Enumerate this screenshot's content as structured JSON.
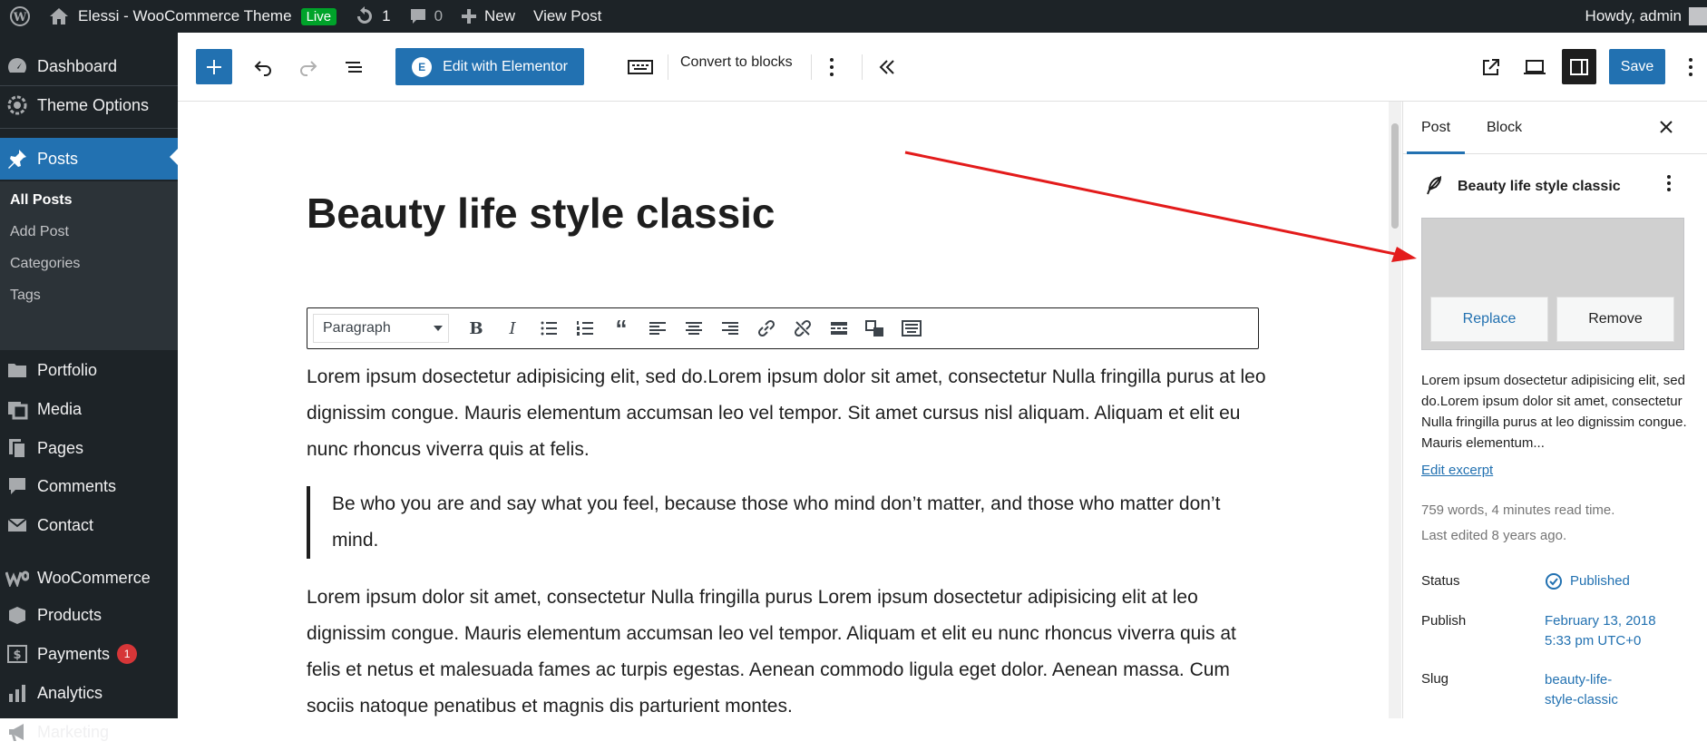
{
  "adminbar": {
    "site_name": "Elessi - WooCommerce Theme",
    "live_badge": "Live",
    "updates_count": "1",
    "comments_count": "0",
    "new_label": "New",
    "view_post_label": "View Post",
    "greeting": "Howdy, admin"
  },
  "sidebar": {
    "items": [
      {
        "label": "Dashboard",
        "icon": "dashboard-icon"
      },
      {
        "label": "Theme Options",
        "icon": "gear-icon"
      },
      {
        "label": "Posts",
        "icon": "pin-icon"
      },
      {
        "label": "Portfolio",
        "icon": "folder-icon"
      },
      {
        "label": "Media",
        "icon": "media-icon"
      },
      {
        "label": "Pages",
        "icon": "pages-icon"
      },
      {
        "label": "Comments",
        "icon": "comment-icon"
      },
      {
        "label": "Contact",
        "icon": "mail-icon"
      },
      {
        "label": "WooCommerce",
        "icon": "woocommerce-icon"
      },
      {
        "label": "Products",
        "icon": "box-icon"
      },
      {
        "label": "Payments",
        "icon": "dollar-icon",
        "badge": "1"
      },
      {
        "label": "Analytics",
        "icon": "bar-chart-icon"
      },
      {
        "label": "Marketing",
        "icon": "megaphone-icon"
      }
    ],
    "submenu": [
      "All Posts",
      "Add Post",
      "Categories",
      "Tags"
    ]
  },
  "toolbar": {
    "elementor_label": "Edit with Elementor",
    "elementor_logo": "E",
    "convert_label": "Convert to blocks",
    "save_label": "Save"
  },
  "editor": {
    "title": "Beauty life style classic",
    "format_select": "Paragraph",
    "paragraph1": "Lorem ipsum dosectetur adipisicing elit, sed do.Lorem ipsum dolor sit amet, consectetur Nulla fringilla purus at leo dignissim congue. Mauris elementum accumsan leo vel tempor. Sit amet cursus nisl aliquam. Aliquam et elit eu nunc rhoncus viverra quis at felis.",
    "quote": "Be who you are and say what you feel, because those who mind don’t matter, and those who matter don’t mind.",
    "paragraph2": "Lorem ipsum dolor sit amet, consectetur Nulla fringilla purus Lorem ipsum dosectetur adipisicing elit at leo dignissim congue. Mauris elementum accumsan leo vel tempor. Aliquam et elit eu nunc rhoncus viverra quis at felis et netus et malesuada fames ac turpis egestas. Aenean commodo ligula eget dolor. Aenean massa. Cum sociis natoque penatibus et magnis dis parturient montes."
  },
  "inspector": {
    "tab_post": "Post",
    "tab_block": "Block",
    "post_title": "Beauty life style classic",
    "replace_label": "Replace",
    "remove_label": "Remove",
    "excerpt": "Lorem ipsum dosectetur adipisicing elit, sed do.Lorem ipsum dolor sit amet, consectetur Nulla fringilla purus at leo dignissim congue. Mauris elementum...",
    "edit_excerpt": "Edit excerpt",
    "read_time": "759 words, 4 minutes read time.",
    "last_edited": "Last edited 8 years ago.",
    "status_label": "Status",
    "status_value": "Published",
    "publish_label": "Publish",
    "publish_value_line1": "February 13, 2018",
    "publish_value_line2": "5:33 pm UTC+0",
    "slug_label": "Slug",
    "slug_value_line1": "beauty-life-",
    "slug_value_line2": "style-classic"
  },
  "colors": {
    "admin_dark": "#1d2327",
    "accent_blue": "#2271b1",
    "live_green": "#00a32a",
    "badge_red": "#d63638",
    "annotation_arrow": "#e31b1b"
  }
}
